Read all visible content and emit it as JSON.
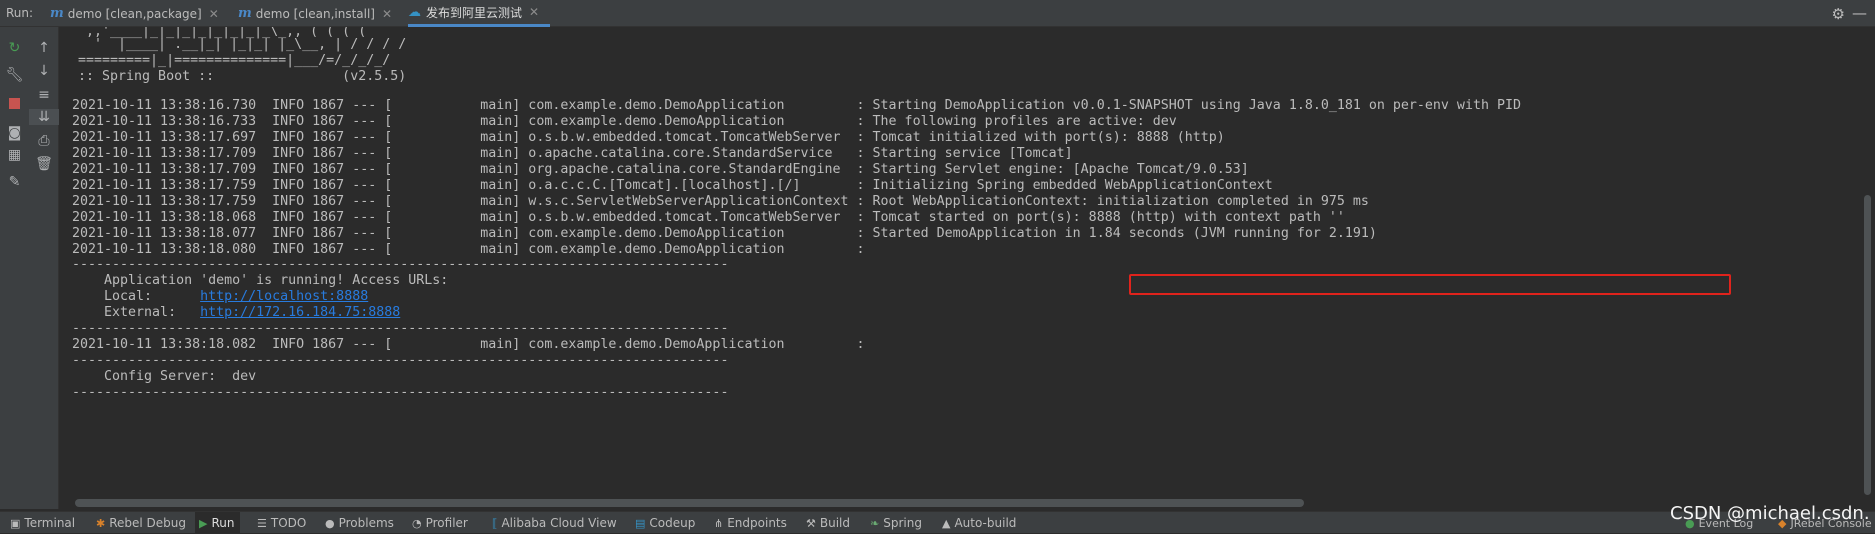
{
  "run_bar": {
    "label": "Run:",
    "tabs": [
      {
        "label": "demo [clean,package]"
      },
      {
        "label": "demo [clean,install]"
      },
      {
        "label": "发布到阿里云测试"
      }
    ]
  },
  "console": {
    "ascii_art": [
      "  ,,'____|_|_|_|_|_|_|_|_\\_,, ( ( ( (",
      "   '  |____| .__|_| |_|_| |_\\__, | / / / /",
      " =========|_|==============|___/=/_/_/_/",
      " :: Spring Boot ::                (v2.5.5)"
    ],
    "log_lines": [
      "2021-10-11 13:38:16.730  INFO 1867 --- [           main] com.example.demo.DemoApplication         : Starting DemoApplication v0.0.1-SNAPSHOT using Java 1.8.0_181 on per-env with PID",
      "2021-10-11 13:38:16.733  INFO 1867 --- [           main] com.example.demo.DemoApplication         : The following profiles are active: dev",
      "2021-10-11 13:38:17.697  INFO 1867 --- [           main] o.s.b.w.embedded.tomcat.TomcatWebServer  : Tomcat initialized with port(s): 8888 (http)",
      "2021-10-11 13:38:17.709  INFO 1867 --- [           main] o.apache.catalina.core.StandardService   : Starting service [Tomcat]",
      "2021-10-11 13:38:17.709  INFO 1867 --- [           main] org.apache.catalina.core.StandardEngine  : Starting Servlet engine: [Apache Tomcat/9.0.53]",
      "2021-10-11 13:38:17.759  INFO 1867 --- [           main] o.a.c.c.C.[Tomcat].[localhost].[/]       : Initializing Spring embedded WebApplicationContext",
      "2021-10-11 13:38:17.759  INFO 1867 --- [           main] w.s.c.ServletWebServerApplicationContext : Root WebApplicationContext: initialization completed in 975 ms",
      "2021-10-11 13:38:18.068  INFO 1867 --- [           main] o.s.b.w.embedded.tomcat.TomcatWebServer  : Tomcat started on port(s): 8888 (http) with context path ''",
      "2021-10-11 13:38:18.077  INFO 1867 --- [           main] com.example.demo.DemoApplication         : Started DemoApplication in 1.84 seconds (JVM running for 2.191)",
      "2021-10-11 13:38:18.080  INFO 1867 --- [           main] com.example.demo.DemoApplication         :"
    ],
    "separator": "----------------------------------------------------------------------------------",
    "access_title": "    Application 'demo' is running! Access URLs:",
    "local_label": "    Local:      ",
    "local_url": "http://localhost:8888",
    "external_label": "    External:   ",
    "external_url": "http://172.16.184.75:8888",
    "log_line_after": "2021-10-11 13:38:18.082  INFO 1867 --- [           main] com.example.demo.DemoApplication         :",
    "config_line": "    Config Server:  dev"
  },
  "bottom_bar": {
    "items": [
      {
        "label": "Terminal"
      },
      {
        "label": "Rebel Debug"
      },
      {
        "label": "Run"
      },
      {
        "label": "TODO"
      },
      {
        "label": "Problems"
      },
      {
        "label": "Profiler"
      },
      {
        "label": "Alibaba Cloud View"
      },
      {
        "label": "Codeup"
      },
      {
        "label": "Endpoints"
      },
      {
        "label": "Build"
      },
      {
        "label": "Spring"
      },
      {
        "label": "Auto-build"
      }
    ],
    "right_items": [
      {
        "label": "Event Log"
      },
      {
        "label": "JRebel Console"
      }
    ]
  },
  "watermark": "CSDN @michael.csdn.",
  "colors": {
    "background": "#2b2b2b",
    "toolbar": "#3c3f41",
    "accent_tab": "#4a88c7",
    "link": "#287bde",
    "highlight_box": "#e0231c",
    "stop_button": "#c75450",
    "rerun_button": "#499c54"
  }
}
